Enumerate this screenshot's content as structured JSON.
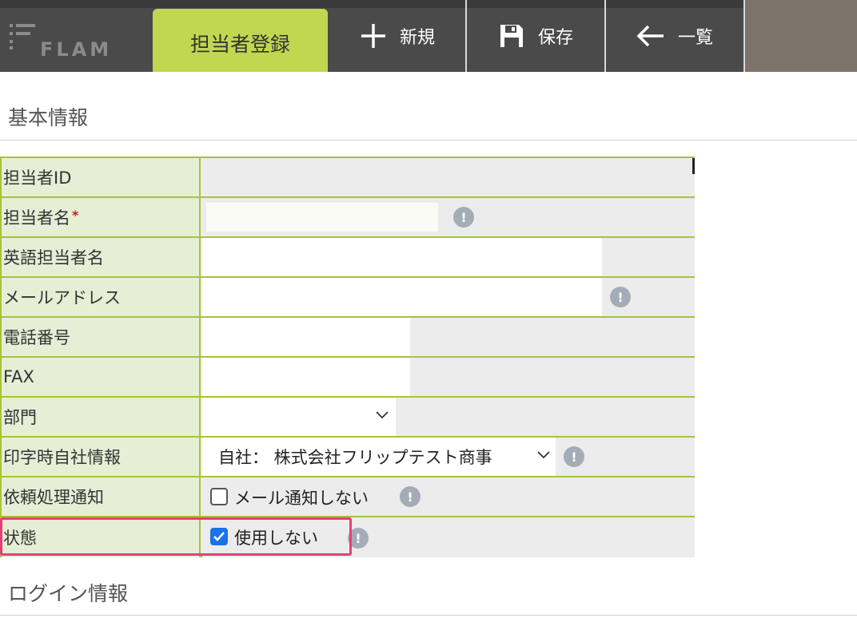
{
  "header": {
    "logo_text": "FLAM",
    "active_tab": "担当者登録",
    "new_label": "新規",
    "save_label": "保存",
    "list_label": "一覧",
    "colors": {
      "bar": "#4a4a4a",
      "active_tab": "#c2d750",
      "right_block": "#7d7469"
    }
  },
  "sections": {
    "basic_info": "基本情報",
    "login_info": "ログイン情報"
  },
  "form": {
    "rows": [
      {
        "label": "担当者ID",
        "value": ""
      },
      {
        "label": "担当者名",
        "required_mark": "*",
        "value": ""
      },
      {
        "label": "英語担当者名",
        "value": ""
      },
      {
        "label": "メールアドレス",
        "value": ""
      },
      {
        "label": "電話番号",
        "value": ""
      },
      {
        "label": "FAX",
        "value": ""
      },
      {
        "label": "部門",
        "value": ""
      },
      {
        "label": "印字時自社情報",
        "value": "自社： 株式会社フリップテスト商事"
      },
      {
        "label": "依頼処理通知",
        "checkbox_label": "メール通知しない",
        "checked": false
      },
      {
        "label": "状態",
        "checkbox_label": "使用しない",
        "checked": true
      }
    ],
    "colors": {
      "border": "#a6c33a",
      "label_bg": "#e6eed6",
      "highlight": "#ec3c7a"
    }
  },
  "icons": {
    "info": "!"
  }
}
